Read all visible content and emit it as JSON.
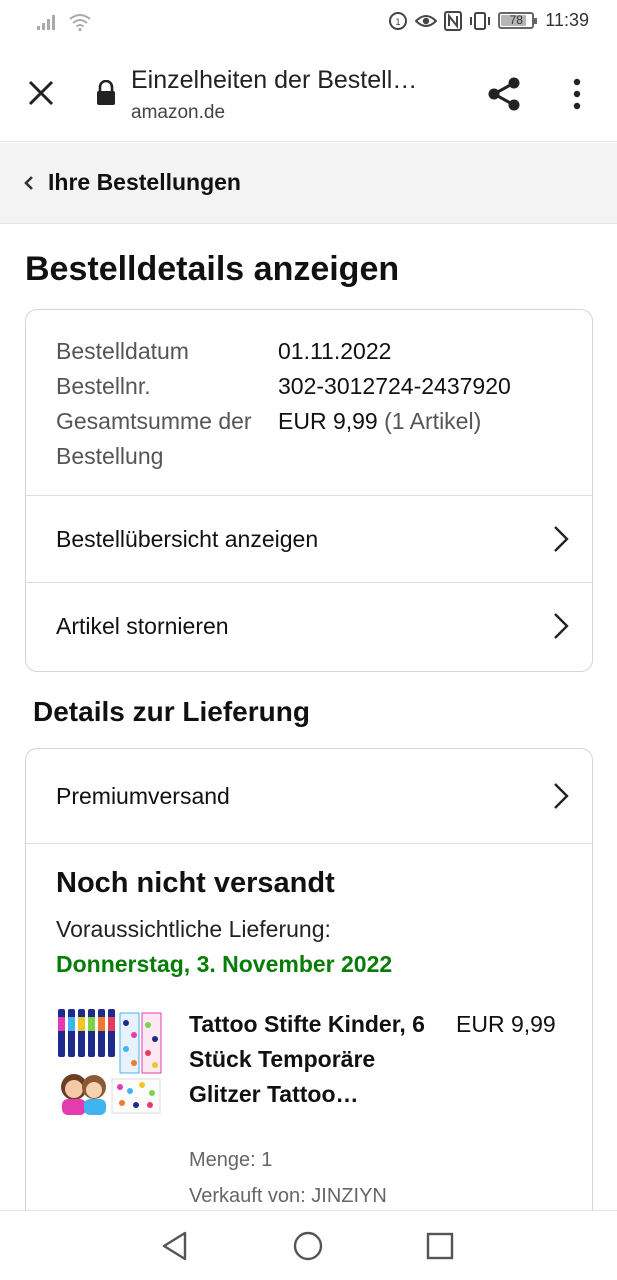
{
  "status_bar": {
    "time": "11:39",
    "battery": "78",
    "icons": [
      "signal-icon",
      "wifi-icon",
      "sync-icon",
      "eye-icon",
      "nfc-icon",
      "vibrate-icon",
      "battery-icon"
    ]
  },
  "browser": {
    "title": "Einzelheiten der Bestell…",
    "url": "amazon.de",
    "icons": [
      "close-icon",
      "lock-icon",
      "share-icon",
      "more-vert-icon"
    ]
  },
  "breadcrumb": {
    "label": "Ihre Bestellungen"
  },
  "page": {
    "title": "Bestelldetails anzeigen"
  },
  "order_summary": {
    "rows": [
      {
        "key": "Bestelldatum",
        "value": "01.11.2022"
      },
      {
        "key": "Bestellnr.",
        "value": "302-3012724-2437920"
      }
    ],
    "total_key": "Gesamtsumme der Bestellung",
    "total_value": "EUR 9,99",
    "total_items": "(1 Artikel)",
    "links": [
      {
        "label": "Bestellübersicht anzeigen"
      },
      {
        "label": "Artikel stornieren"
      }
    ]
  },
  "delivery": {
    "section_title": "Details zur Lieferung",
    "shipping_method": "Premiumversand",
    "status": "Noch nicht versandt",
    "eta_label": "Voraussichtliche Lieferung:",
    "eta_date": "Donnerstag, 3. November 2022",
    "eta_color": "#067d06",
    "product": {
      "title": "Tattoo Stifte Kinder, 6 Stück Temporäre Glitzer Tattoo…",
      "price": "EUR 9,99",
      "quantity": "Menge: 1",
      "seller": "Verkauft von: JINZIYN"
    }
  },
  "navbar": {
    "icons": [
      "back-triangle-icon",
      "home-circle-icon",
      "recents-square-icon"
    ]
  }
}
